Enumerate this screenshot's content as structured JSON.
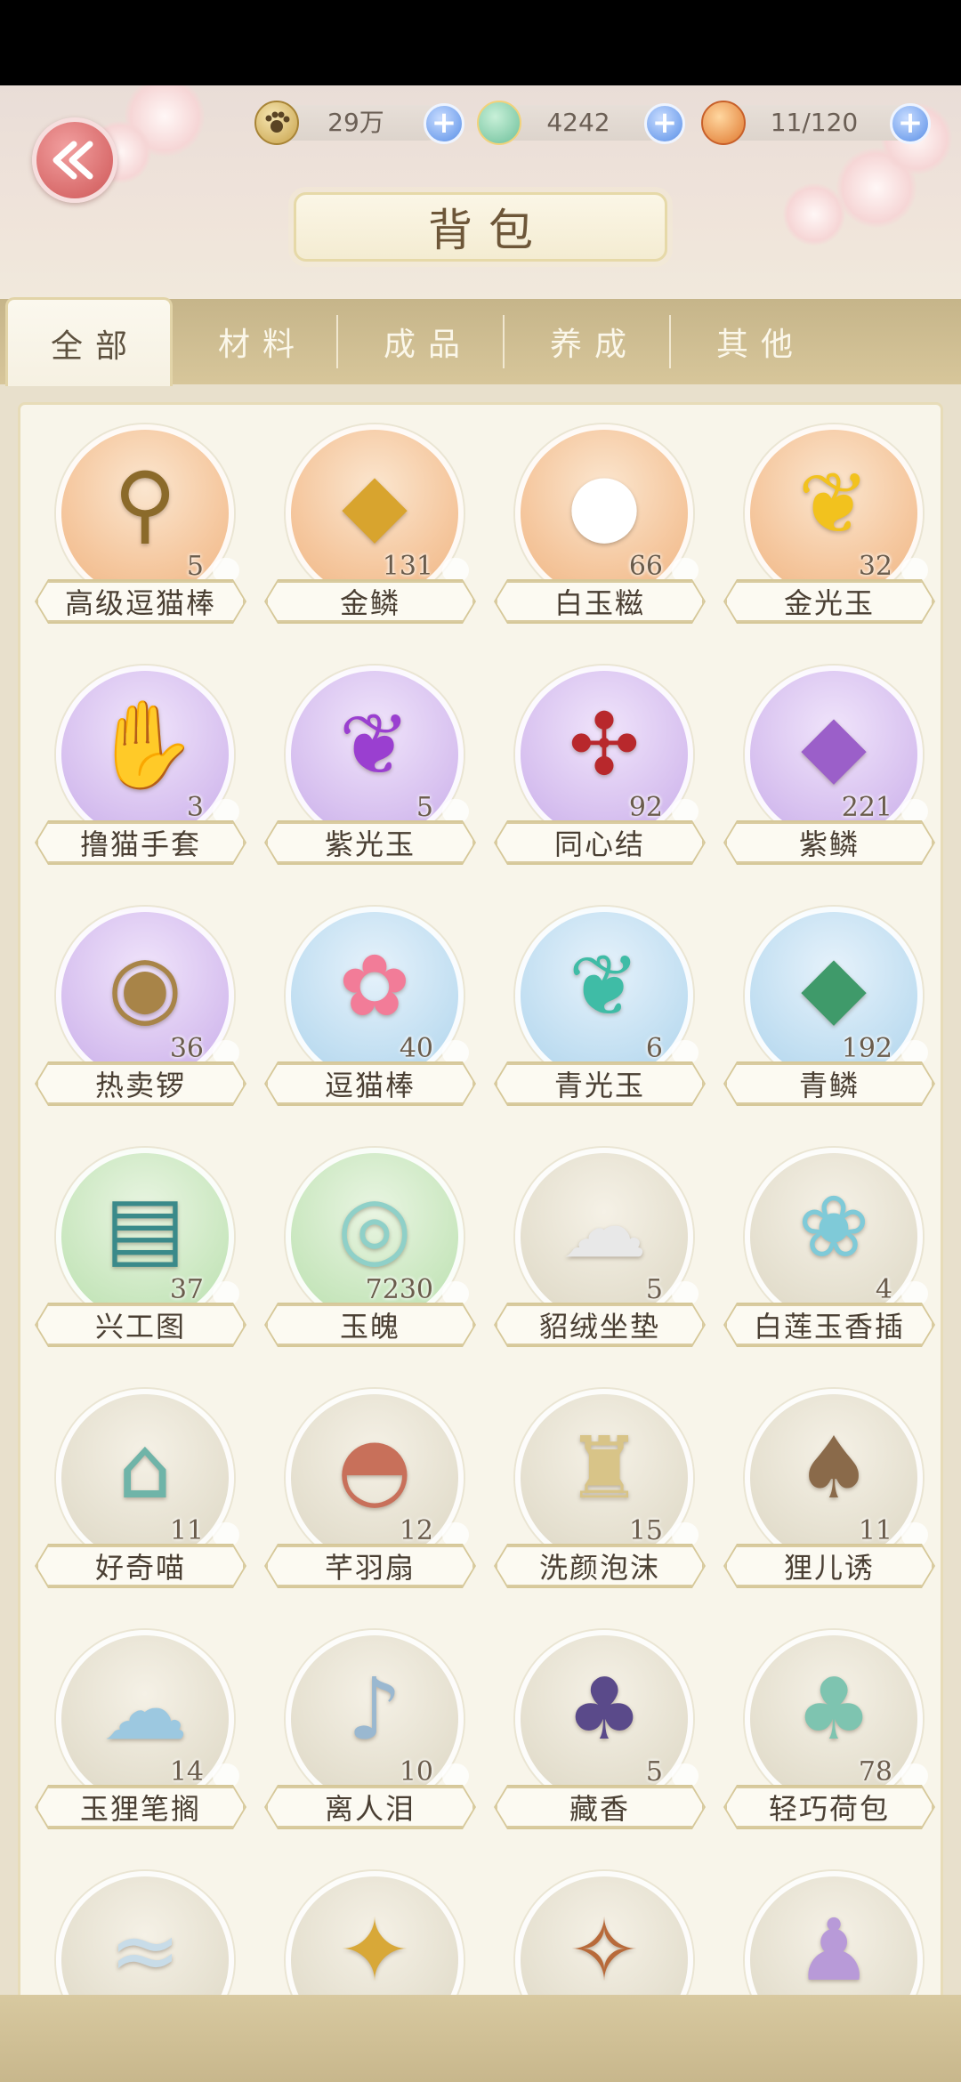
{
  "header": {
    "title": "背包",
    "back_icon": "back-arrow-icon",
    "currencies": [
      {
        "name": "paw-coin",
        "icon": "paw-coin-icon",
        "value": "29万"
      },
      {
        "name": "jade-bird",
        "icon": "jade-bird-icon",
        "value": "4242"
      },
      {
        "name": "food",
        "icon": "food-bowl-icon",
        "value": "11/120"
      }
    ]
  },
  "tabs": [
    {
      "label": "全部",
      "active": true
    },
    {
      "label": "材料",
      "active": false
    },
    {
      "label": "成品",
      "active": false
    },
    {
      "label": "养成",
      "active": false
    },
    {
      "label": "其他",
      "active": false
    }
  ],
  "items": [
    {
      "name": "高级逗猫棒",
      "count": "5",
      "bg": "orange",
      "icon": "cat-teaser-icon",
      "color": "#8b6a2a"
    },
    {
      "name": "金鳞",
      "count": "131",
      "bg": "orange",
      "icon": "gold-scale-icon",
      "color": "#d8a42e"
    },
    {
      "name": "白玉糍",
      "count": "66",
      "bg": "orange",
      "icon": "white-mochi-icon",
      "color": "#ffffff"
    },
    {
      "name": "金光玉",
      "count": "32",
      "bg": "orange",
      "icon": "gold-fish-icon",
      "color": "#f2c21e"
    },
    {
      "name": "撸猫手套",
      "count": "3",
      "bg": "purple",
      "icon": "paw-glove-icon",
      "color": "#ffffff"
    },
    {
      "name": "紫光玉",
      "count": "5",
      "bg": "purple",
      "icon": "purple-fish-icon",
      "color": "#9a3fd0"
    },
    {
      "name": "同心结",
      "count": "92",
      "bg": "purple",
      "icon": "knot-icon",
      "color": "#b8282c"
    },
    {
      "name": "紫鳞",
      "count": "221",
      "bg": "purple",
      "icon": "purple-scale-icon",
      "color": "#9b5fc9"
    },
    {
      "name": "热卖锣",
      "count": "36",
      "bg": "purple",
      "icon": "gong-icon",
      "color": "#a88448"
    },
    {
      "name": "逗猫棒",
      "count": "40",
      "bg": "blue",
      "icon": "feather-wand-icon",
      "color": "#f27c98"
    },
    {
      "name": "青光玉",
      "count": "6",
      "bg": "blue",
      "icon": "teal-fish-icon",
      "color": "#3fbca6"
    },
    {
      "name": "青鳞",
      "count": "192",
      "bg": "blue",
      "icon": "green-scale-icon",
      "color": "#3f9a6a"
    },
    {
      "name": "兴工图",
      "count": "37",
      "bg": "green",
      "icon": "scroll-icon",
      "color": "#3a8a8a"
    },
    {
      "name": "玉魄",
      "count": "7230",
      "bg": "green",
      "icon": "jade-disc-icon",
      "color": "#8fd0c8"
    },
    {
      "name": "貂绒坐垫",
      "count": "5",
      "bg": "beige",
      "icon": "cushion-icon",
      "color": "#e8e8e8"
    },
    {
      "name": "白莲玉香插",
      "count": "4",
      "bg": "beige",
      "icon": "lotus-icon",
      "color": "#7fcad8"
    },
    {
      "name": "好奇喵",
      "count": "11",
      "bg": "beige",
      "icon": "cat-jar-icon",
      "color": "#6fb4a8"
    },
    {
      "name": "芊羽扇",
      "count": "12",
      "bg": "beige",
      "icon": "fan-icon",
      "color": "#c8705a"
    },
    {
      "name": "洗颜泡沫",
      "count": "15",
      "bg": "beige",
      "icon": "cream-bottle-icon",
      "color": "#d8c488"
    },
    {
      "name": "狸儿诱",
      "count": "11",
      "bg": "beige",
      "icon": "pouch-icon",
      "color": "#8a6a4a"
    },
    {
      "name": "玉狸笔搁",
      "count": "14",
      "bg": "beige",
      "icon": "jade-cat-icon",
      "color": "#9cc8e0"
    },
    {
      "name": "离人泪",
      "count": "10",
      "bg": "beige",
      "icon": "earring-icon",
      "color": "#9ab8d0"
    },
    {
      "name": "藏香",
      "count": "5",
      "bg": "beige",
      "icon": "incense-bag-icon",
      "color": "#5a4a8a"
    },
    {
      "name": "轻巧荷包",
      "count": "78",
      "bg": "beige",
      "icon": "green-pouch-icon",
      "color": "#7ec4b0"
    },
    {
      "name": "",
      "count": "",
      "bg": "beige",
      "icon": "silk-cloth-icon",
      "color": "#c8dce8"
    },
    {
      "name": "",
      "count": "",
      "bg": "beige",
      "icon": "hairpin-icon",
      "color": "#d8a838"
    },
    {
      "name": "",
      "count": "",
      "bg": "beige",
      "icon": "ornament-icon",
      "color": "#b86a3a"
    },
    {
      "name": "",
      "count": "",
      "bg": "beige",
      "icon": "purple-garment-icon",
      "color": "#b89ad8"
    }
  ]
}
